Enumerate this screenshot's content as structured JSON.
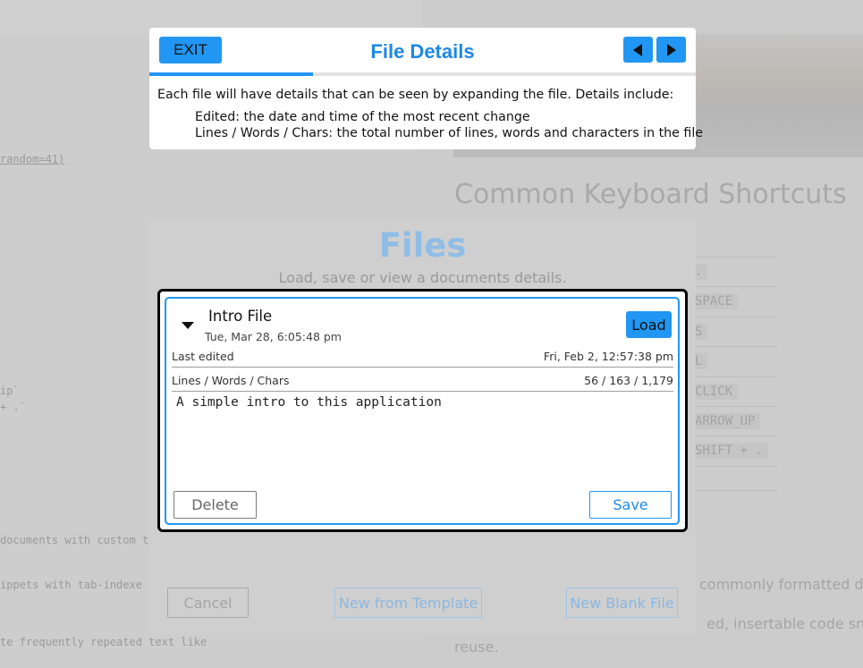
{
  "background": {
    "code_lines": [
      "random=41)",
      "ip`",
      "+ .`",
      "documents with custom t",
      "ippets with tab-indexe",
      "te frequently repeated text like"
    ],
    "right_heading": "Common Keyboard Shortcuts",
    "shortcut_keys": [
      ".",
      "SPACE",
      "S",
      "L",
      "CLICK",
      "ARROW_UP",
      "SHIFT + ."
    ],
    "right_text_lines": [
      "commonly formatted d",
      "ed, insertable code snipp",
      "reuse."
    ]
  },
  "help": {
    "exit_label": "EXIT",
    "title": "File Details",
    "progress_fraction": 0.3,
    "intro": "Each file will have details that can be seen by expanding the file. Details include:",
    "items": [
      "Edited: the date and time of the most recent change",
      "Lines / Words / Chars: the total number of lines, words and characters in the file"
    ]
  },
  "files": {
    "title": "Files",
    "subtitle": "Load, save or view a documents details.",
    "file": {
      "name": "Intro File",
      "date": "Tue, Mar 28, 6:05:48 pm",
      "load_label": "Load",
      "last_edited_label": "Last edited",
      "last_edited_value": "Fri, Feb 2, 12:57:38 pm",
      "stats_label": "Lines / Words / Chars",
      "stats_value": "56 / 163 / 1,179",
      "content": "A simple intro to this application",
      "delete_label": "Delete",
      "save_label": "Save"
    },
    "cancel_label": "Cancel",
    "template_label": "New from Template",
    "blank_label": "New Blank File"
  },
  "colors": {
    "accent": "#2196f3",
    "title_blue": "#1e88e5",
    "highlight_border": "#000000",
    "overlay": "#d2d2d2"
  }
}
